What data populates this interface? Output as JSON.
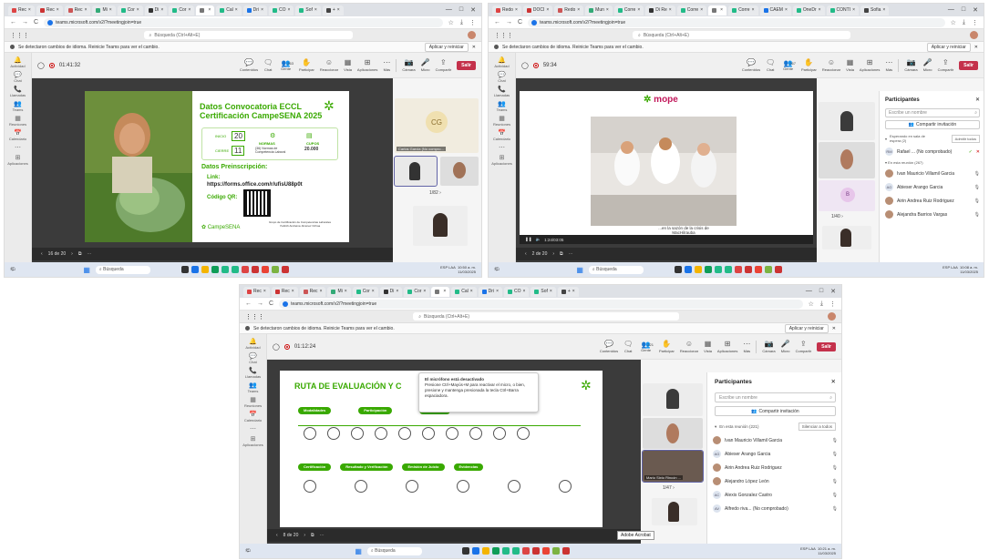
{
  "tab_labels": [
    "Rec",
    "Rec",
    "Rec",
    "Mi",
    "Cor",
    "Di",
    "Cor",
    "",
    "Cal",
    "Dri",
    "CO",
    "Sof",
    "+"
  ],
  "tab_labels_b": [
    "Redo",
    "DOCI",
    "Redo",
    "Mun",
    "Corre",
    "Di Re",
    "Corre",
    "",
    "Corre",
    "CAEM",
    "OneDr",
    "CONTI",
    "Sofia"
  ],
  "url": "teams.microsoft.com/v2/?meetingjoin=true",
  "search_placeholder": "Búsqueda (Ctrl+Alt+E)",
  "notice_text": "Se detectaron cambios de idioma. Reinicie Teams para ver el cambio.",
  "apply_label": "Aplicar y reiniciar",
  "rail": [
    {
      "icon": "🔔",
      "label": "Actividad"
    },
    {
      "icon": "💬",
      "label": "Chat"
    },
    {
      "icon": "📞",
      "label": "Llamadas"
    },
    {
      "icon": "👥",
      "label": "Teams"
    },
    {
      "icon": "▦",
      "label": "Reuniones"
    },
    {
      "icon": "📅",
      "label": "Calendario"
    },
    {
      "icon": "⋯",
      "label": ""
    },
    {
      "icon": "⊞",
      "label": "Aplicaciones"
    }
  ],
  "controls": [
    {
      "icon": "💬",
      "label": "Contenidos"
    },
    {
      "icon": "🗨",
      "label": "Chat"
    },
    {
      "icon": "👥",
      "label": "Gente"
    },
    {
      "icon": "✋",
      "label": "Participar"
    },
    {
      "icon": "☺",
      "label": "Reaccionar"
    },
    {
      "icon": "▦",
      "label": "Vista"
    },
    {
      "icon": "⊞",
      "label": "Aplicaciones"
    },
    {
      "icon": "⋯",
      "label": "Más"
    }
  ],
  "media": [
    {
      "icon": "📷",
      "label": "Cámara"
    },
    {
      "icon": "🎤",
      "label": "Micro"
    },
    {
      "icon": "⇪",
      "label": "Compartir"
    }
  ],
  "leave_label": "Salir",
  "s1": {
    "timer": "01:41:32",
    "people_count": "263",
    "slide_title": "Datos Convocatoria ECCL",
    "slide_title2": "Certificación CampeSENA 2025",
    "inicio_label": "INICIO",
    "inicio_num": "20",
    "cierre_label": "CIERRE",
    "cierre_num": "11",
    "normas_label": "NORMAS",
    "normas_desc": "(36) Normas de Competencia Laboral",
    "cupos_label": "CUPOS",
    "cupos_num": "20.000",
    "pre_title": "Datos Preinscripción:",
    "link_label": "Link:",
    "link_url": "https://forms.office.com/r/ufisU88p0t",
    "qr_label": "Código QR:",
    "campesena": "CampeSENA",
    "footer": "Grupo de Certificación de Competencias Laborales",
    "footer2": "Yudinth Andreina Jiménez Ochoa",
    "page": "16 de 20",
    "cg": "CG",
    "cg_name": "Carlos Garcia (No compro...",
    "tile_page": "1/82"
  },
  "s2": {
    "timer": "59:34",
    "people_count": "267",
    "mope": "mope",
    "video_time": "1:24/03:05",
    "caption": "...en la sazón de la crisis de MacHilrauba",
    "page": "2 de 20",
    "tile_initial": "B",
    "tile_page": "1/40",
    "panel_title": "Participantes",
    "invite_ph": "Escribe un nombre",
    "share_inv": "Compartir invitación",
    "waiting": "Esperando en sala de espera (2)",
    "admit_all": "Admitir todos",
    "waiting_person": "Rafael ... (No comprobado)",
    "in_meeting": "En esta reunión (267)",
    "people": [
      {
        "name": "Ivan Mauricio Villamil Garcia",
        "ini": ""
      },
      {
        "name": "Abieser Arango Garcia",
        "ini": "AG"
      },
      {
        "name": "Airin Andrea Ruiz Rodriguez",
        "ini": ""
      },
      {
        "name": "Alejandra Barrios Vargas",
        "ini": ""
      }
    ]
  },
  "s3": {
    "timer": "01:12:24",
    "people_count": "221",
    "slide_title": "RUTA DE EVALUACIÓN Y C",
    "tooltip_title": "El micrófono está desactivado",
    "tooltip_body": "Presione Ctrl+Mayús+M para reactivar el micro, o bien, presione y mantenga presionada la tecla Ctrl+Barra espaciadora.",
    "row1": [
      "Modalidades",
      "Participación",
      "Inscripción"
    ],
    "row2": [
      "Certificación",
      "Resultado y Verificación",
      "Emisión de Juicio",
      "Evidencias"
    ],
    "page": "8 de 20",
    "tile_name": "Mario Sixto Rincón ...",
    "tile_page": "1/47",
    "tooltip2": "Adobe Acrobat",
    "panel_title": "Participantes",
    "invite_ph": "Escribe un nombre",
    "share_inv": "Compartir invitación",
    "in_meeting": "En esta reunión (221)",
    "mute_all": "Silenciar a todos",
    "people": [
      {
        "name": "Ivan Mauricio Villamil Garcia",
        "ini": ""
      },
      {
        "name": "Abieser Arango Garcia",
        "ini": "AG"
      },
      {
        "name": "Airin Andrea Ruiz Rodriguez",
        "ini": ""
      },
      {
        "name": "Alejandro López León",
        "ini": ""
      },
      {
        "name": "Alexis Gonzalez Castro",
        "ini": "AC"
      },
      {
        "name": "Alfredo riva... (No comprobado)",
        "ini": "AV"
      }
    ]
  },
  "taskbar": {
    "search": "Búsqueda",
    "lang": "ESP LAA"
  },
  "clocks": [
    {
      "time": "10:50 a. m.",
      "date": "11/03/2025"
    },
    {
      "time": "10:08 a. m.",
      "date": "11/03/2025"
    },
    {
      "time": "10:21 a. m.",
      "date": "11/03/2025"
    }
  ]
}
